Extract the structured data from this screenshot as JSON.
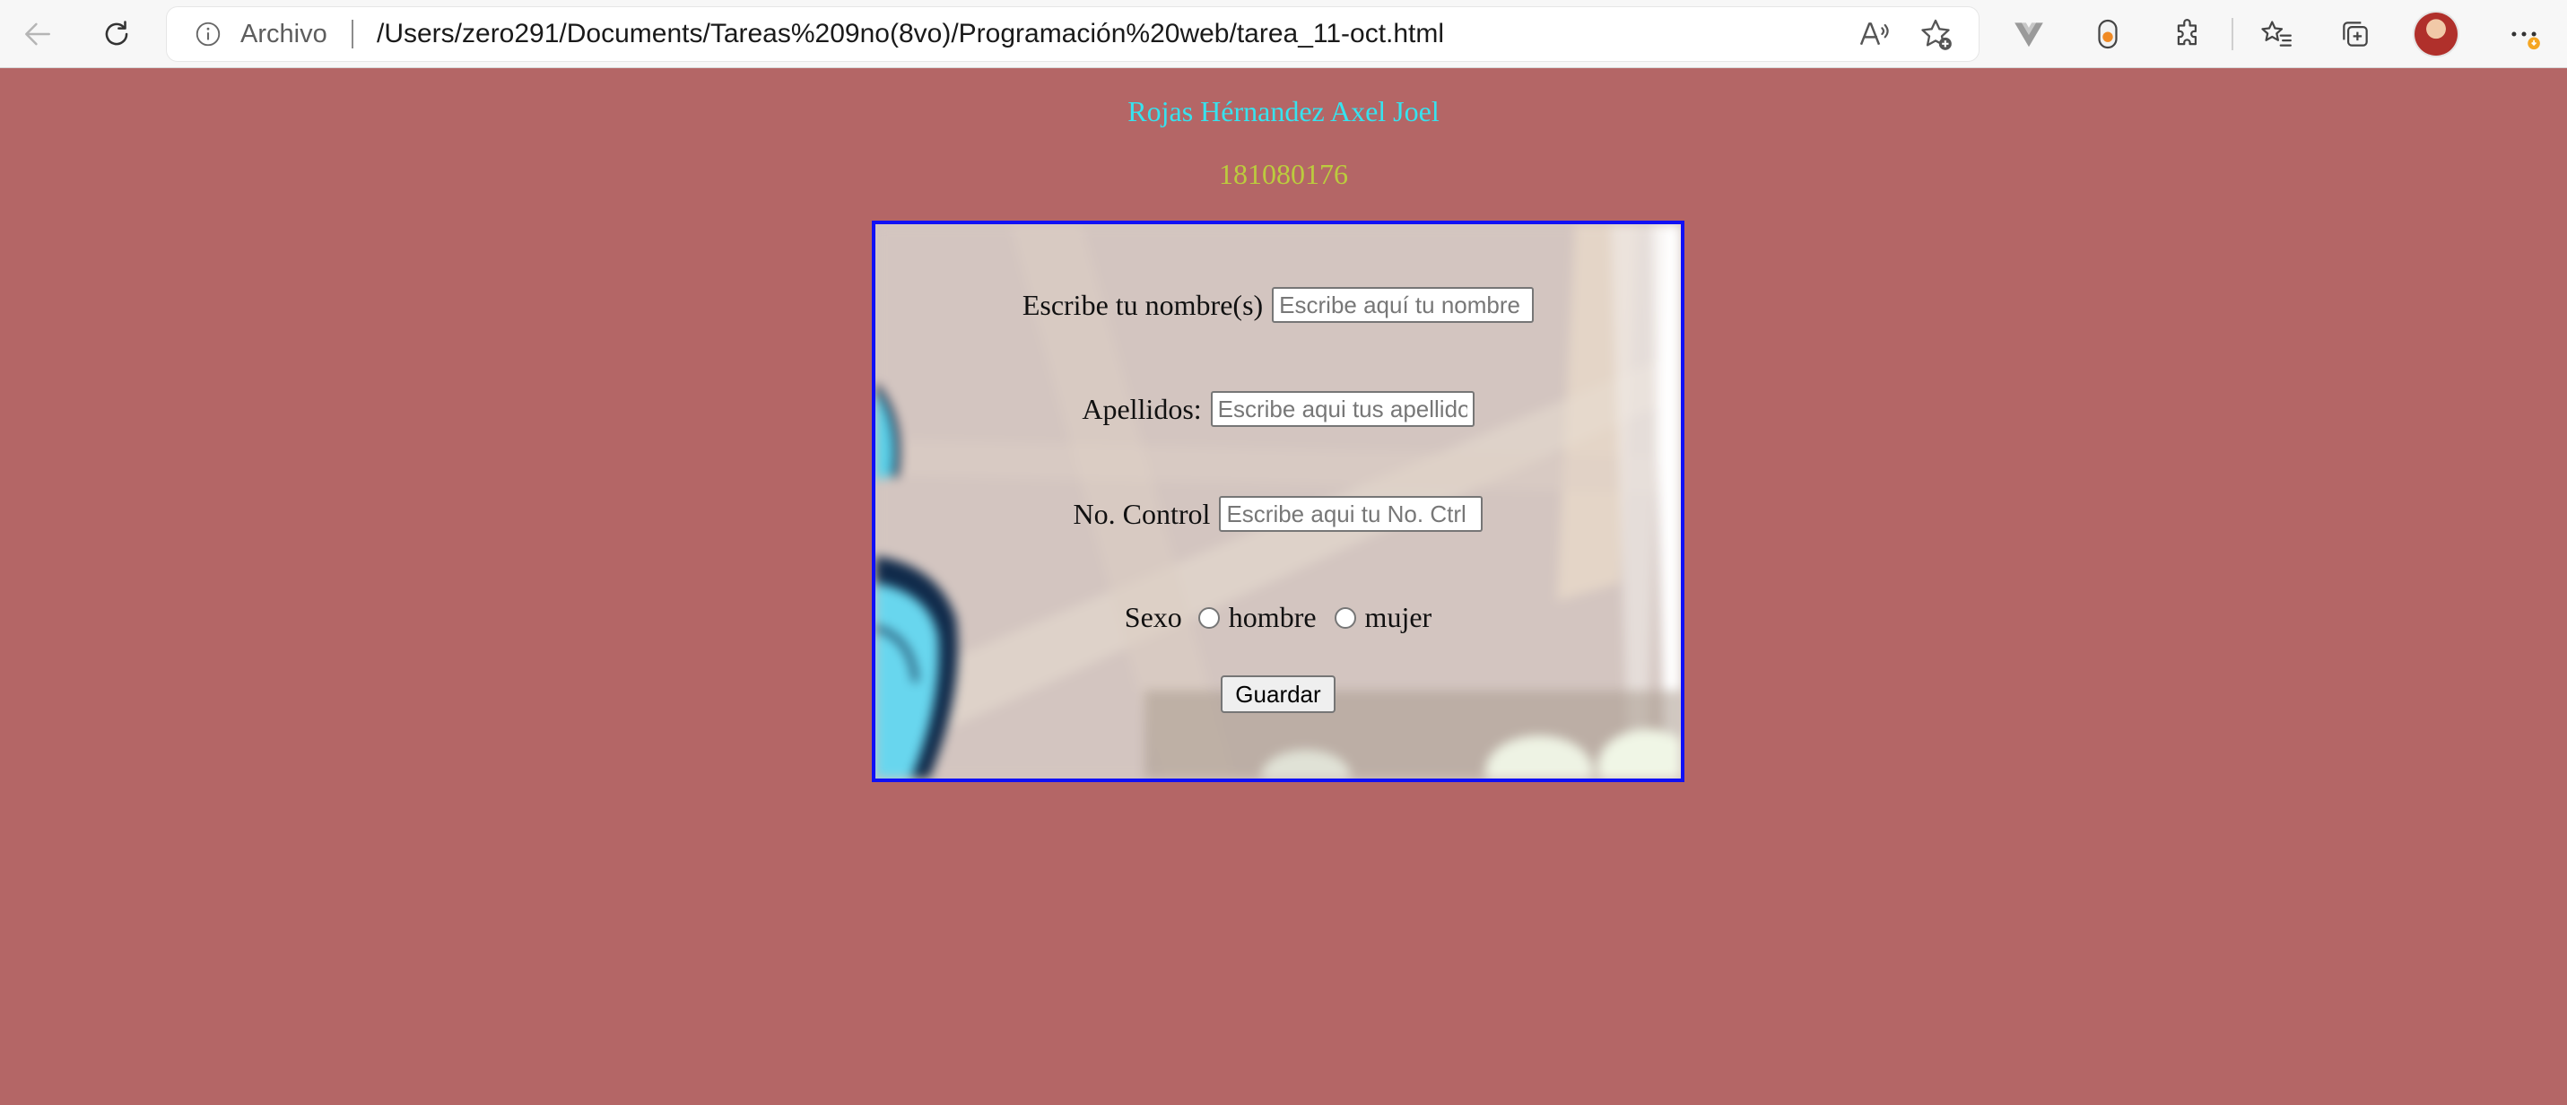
{
  "browser": {
    "address_label": "Archivo",
    "url": "/Users/zero291/Documents/Tareas%209no(8vo)/Programación%20web/tarea_11-oct.html"
  },
  "page": {
    "student_name": "Rojas Hérnandez Axel Joel",
    "control_number": "181080176",
    "colors": {
      "background": "#b46666",
      "name_text": "#36e3ef",
      "number_text": "#bccb3e",
      "form_border": "#1010f5"
    }
  },
  "form": {
    "nombre": {
      "label": "Escribe tu nombre(s)",
      "placeholder": "Escribe aquí tu nombre"
    },
    "apellidos": {
      "label": "Apellidos:",
      "placeholder": "Escribe aqui tus apellidos"
    },
    "control": {
      "label": "No. Control",
      "placeholder": "Escribe aqui tu No. Ctrl"
    },
    "sexo": {
      "label": "Sexo",
      "options": [
        "hombre",
        "mujer"
      ]
    },
    "save_label": "Guardar"
  }
}
